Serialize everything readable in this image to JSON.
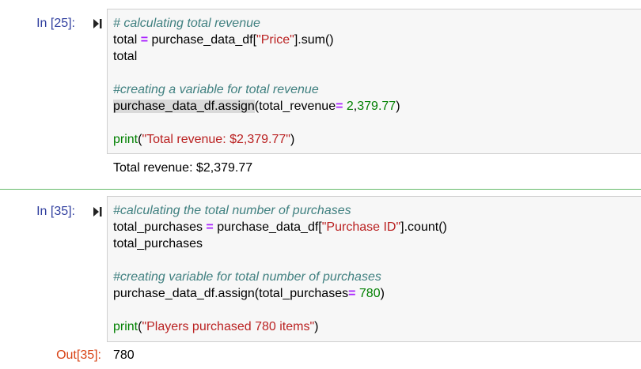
{
  "cells": [
    {
      "prompt": "In [25]:",
      "lines": [
        [
          {
            "t": "# calculating total revenue",
            "c": "cm"
          }
        ],
        [
          {
            "t": "total ",
            "c": ""
          },
          {
            "t": "=",
            "c": "op"
          },
          {
            "t": " purchase_data_df[",
            "c": ""
          },
          {
            "t": "\"Price\"",
            "c": "str"
          },
          {
            "t": "].sum()",
            "c": ""
          }
        ],
        [
          {
            "t": "total",
            "c": ""
          }
        ],
        [
          {
            "t": "",
            "c": ""
          }
        ],
        [
          {
            "t": "#creating a variable for total revenue",
            "c": "cm"
          }
        ],
        [
          {
            "t": "purchase_data_df.assign",
            "c": "hl"
          },
          {
            "t": "(total_revenue",
            "c": ""
          },
          {
            "t": "=",
            "c": "op"
          },
          {
            "t": " ",
            "c": ""
          },
          {
            "t": "2",
            "c": "num"
          },
          {
            "t": ",",
            "c": ""
          },
          {
            "t": "379.77",
            "c": "num"
          },
          {
            "t": ")",
            "c": ""
          }
        ],
        [
          {
            "t": "",
            "c": ""
          }
        ],
        [
          {
            "t": "print",
            "c": "builtin"
          },
          {
            "t": "(",
            "c": ""
          },
          {
            "t": "\"Total revenue: $2,379.77\"",
            "c": "str"
          },
          {
            "t": ")",
            "c": ""
          }
        ]
      ],
      "output_prompt": "",
      "output": "Total revenue: $2,379.77"
    },
    {
      "prompt": "In [35]:",
      "lines": [
        [
          {
            "t": "#calculating the total number of purchases",
            "c": "cm"
          }
        ],
        [
          {
            "t": "total_purchases ",
            "c": ""
          },
          {
            "t": "=",
            "c": "op"
          },
          {
            "t": " purchase_data_df[",
            "c": ""
          },
          {
            "t": "\"Purchase ID\"",
            "c": "str"
          },
          {
            "t": "].count()",
            "c": ""
          }
        ],
        [
          {
            "t": "total_purchases",
            "c": ""
          }
        ],
        [
          {
            "t": "",
            "c": ""
          }
        ],
        [
          {
            "t": "#creating variable for total number of purchases",
            "c": "cm"
          }
        ],
        [
          {
            "t": "purchase_data_df.assign(total_purchases",
            "c": ""
          },
          {
            "t": "=",
            "c": "op"
          },
          {
            "t": " ",
            "c": ""
          },
          {
            "t": "780",
            "c": "num"
          },
          {
            "t": ")",
            "c": ""
          }
        ],
        [
          {
            "t": "",
            "c": ""
          }
        ],
        [
          {
            "t": "print",
            "c": "builtin"
          },
          {
            "t": "(",
            "c": ""
          },
          {
            "t": "\"Players purchased 780 items\"",
            "c": "str"
          },
          {
            "t": ")",
            "c": ""
          }
        ]
      ],
      "output_prompt": "Out[35]:",
      "output": "780"
    }
  ],
  "colors": {
    "in_prompt": "#303f9f",
    "out_prompt": "#d84315",
    "selected_border": "#66bb6a"
  },
  "icons": {
    "run": "run-cell-icon"
  }
}
